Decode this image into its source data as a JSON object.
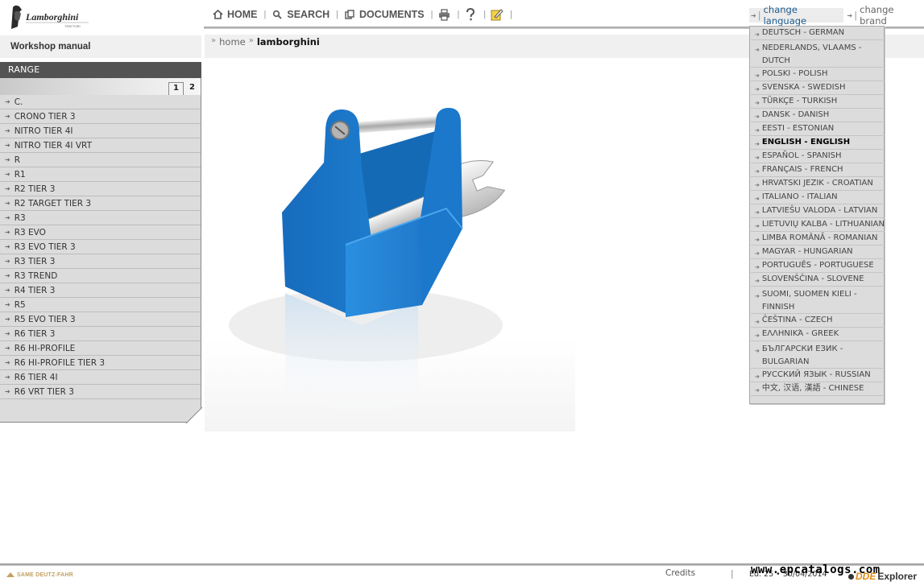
{
  "header": {
    "logo_text": "Lamborghini",
    "logo_subtext": "TRATTORI",
    "nav": [
      {
        "label": "HOME",
        "icon": "home-icon"
      },
      {
        "label": "SEARCH",
        "icon": "search-icon"
      },
      {
        "label": "DOCUMENTS",
        "icon": "documents-icon"
      }
    ],
    "icons": [
      "print-icon",
      "help-icon",
      "notes-icon"
    ],
    "separator": "|",
    "change_language": "change language",
    "change_brand": "change brand"
  },
  "sidebar": {
    "title": "Workshop manual",
    "range_label": "RANGE",
    "tabs": [
      "1",
      "2"
    ],
    "items": [
      "C.",
      "CRONO TIER 3",
      "NITRO TIER 4I",
      "NITRO TIER 4I VRT",
      "R",
      "R1",
      "R2 TIER 3",
      "R2 TARGET TIER 3",
      "R3",
      "R3 EVO",
      "R3 EVO TIER 3",
      "R3 TIER 3",
      "R3 TREND",
      "R4 TIER 3",
      "R5",
      "R5 EVO TIER 3",
      "R6 TIER 3",
      "R6 HI-PROFILE",
      "R6 HI-PROFILE TIER 3",
      "R6 TIER 4I",
      "R6 VRT TIER 3"
    ]
  },
  "breadcrumb": {
    "sep": "»",
    "home": "home",
    "current": "lamborghini"
  },
  "languages": [
    {
      "label": "DEUTSCH - GERMAN"
    },
    {
      "label": "NEDERLANDS, VLAAMS - DUTCH"
    },
    {
      "label": "POLSKI - POLISH"
    },
    {
      "label": "SVENSKA - SWEDISH"
    },
    {
      "label": "TÜRKÇE - TURKISH"
    },
    {
      "label": "DANSK - DANISH"
    },
    {
      "label": "EESTI - ESTONIAN"
    },
    {
      "label": "ENGLISH - ENGLISH",
      "selected": true
    },
    {
      "label": "ESPAÑOL - SPANISH"
    },
    {
      "label": "FRANÇAIS - FRENCH"
    },
    {
      "label": "HRVATSKI JEZIK - CROATIAN"
    },
    {
      "label": "ITALIANO - ITALIAN"
    },
    {
      "label": "LATVIEŠU VALODA - LATVIAN"
    },
    {
      "label": "LIETUVIŲ KALBA - LITHUANIAN"
    },
    {
      "label": "LIMBA ROMÂNĂ - ROMANIAN"
    },
    {
      "label": "MAGYAR - HUNGARIAN"
    },
    {
      "label": "PORTUGUÊS - PORTUGUESE"
    },
    {
      "label": "SLOVENŠČINA - SLOVENE"
    },
    {
      "label": "SUOMI, SUOMEN KIELI - FINNISH"
    },
    {
      "label": "ČEŠTINA - CZECH"
    },
    {
      "label": "ΕΛΛΗΝΙΚΆ - GREEK"
    },
    {
      "label": "БЪЛГАРСКИ ЕЗИК - BULGARIAN"
    },
    {
      "label": "РУССКИЙ ЯЗЫК - RUSSIAN"
    },
    {
      "label": "中文, 汉语, 漢語 - CHINESE"
    }
  ],
  "footer": {
    "brand": "SAME DEUTZ-FAHR",
    "credits": "Credits",
    "divider": "|",
    "version": "Ed. 25 • 30/04/2014",
    "watermark": "www.epcatalogs.com",
    "logo_prefix": "DDE",
    "logo_text": "Explorer"
  },
  "colors": {
    "accent_link": "#1c5b8e",
    "toolbox_blue": "#1f86d6",
    "range_header_bg": "#535353",
    "panel_bg": "#dcdcdc"
  }
}
